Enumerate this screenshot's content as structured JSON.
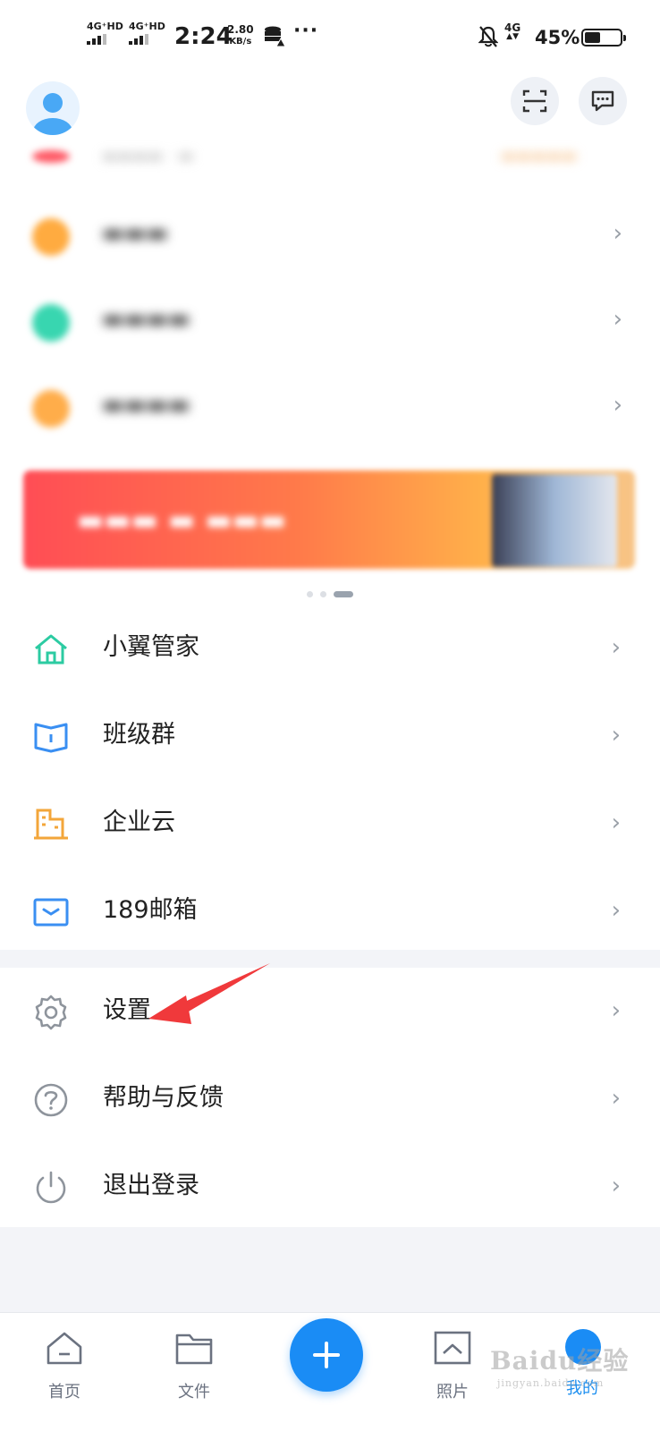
{
  "status_bar": {
    "sim1_label": "4G⁺HD",
    "sim2_label": "4G⁺HD",
    "time": "2:24",
    "speed_value": "2.80",
    "speed_unit": "KB/s",
    "more": "···",
    "net_type": "4G",
    "battery_percent": "45%",
    "battery_level": 0.45
  },
  "header": {
    "avatar_icon": "user-avatar-icon",
    "scan_icon": "scan-icon",
    "message_icon": "message-icon"
  },
  "pager": {
    "count": 3,
    "active_index": 2
  },
  "menu_main": [
    {
      "label": "小翼管家",
      "icon": "home-icon",
      "color": "#2ccba2"
    },
    {
      "label": "班级群",
      "icon": "book-icon",
      "color": "#3a8ff2"
    },
    {
      "label": "企业云",
      "icon": "building-icon",
      "color": "#f3a63a"
    },
    {
      "label": "189邮箱",
      "icon": "mail-icon",
      "color": "#3a8ff2"
    }
  ],
  "menu_settings": [
    {
      "label": "设置",
      "icon": "gear-icon"
    },
    {
      "label": "帮助与反馈",
      "icon": "help-icon"
    },
    {
      "label": "退出登录",
      "icon": "power-icon"
    }
  ],
  "chevron": "›",
  "tabbar": {
    "tabs": [
      {
        "label": "首页",
        "icon": "home-tab-icon",
        "active": false
      },
      {
        "label": "文件",
        "icon": "folder-tab-icon",
        "active": false
      },
      {
        "label": "照片",
        "icon": "photo-tab-icon",
        "active": false
      },
      {
        "label": "我的",
        "icon": "profile-tab-icon",
        "active": true
      }
    ],
    "fab_icon": "plus-icon"
  },
  "colors": {
    "accent": "#1a8cf5",
    "annotation_red": "#f0393b",
    "chevron_gray": "#9aa0a8"
  },
  "watermark": {
    "brand": "Baidu经验",
    "sub": "jingyan.baidu.com"
  }
}
